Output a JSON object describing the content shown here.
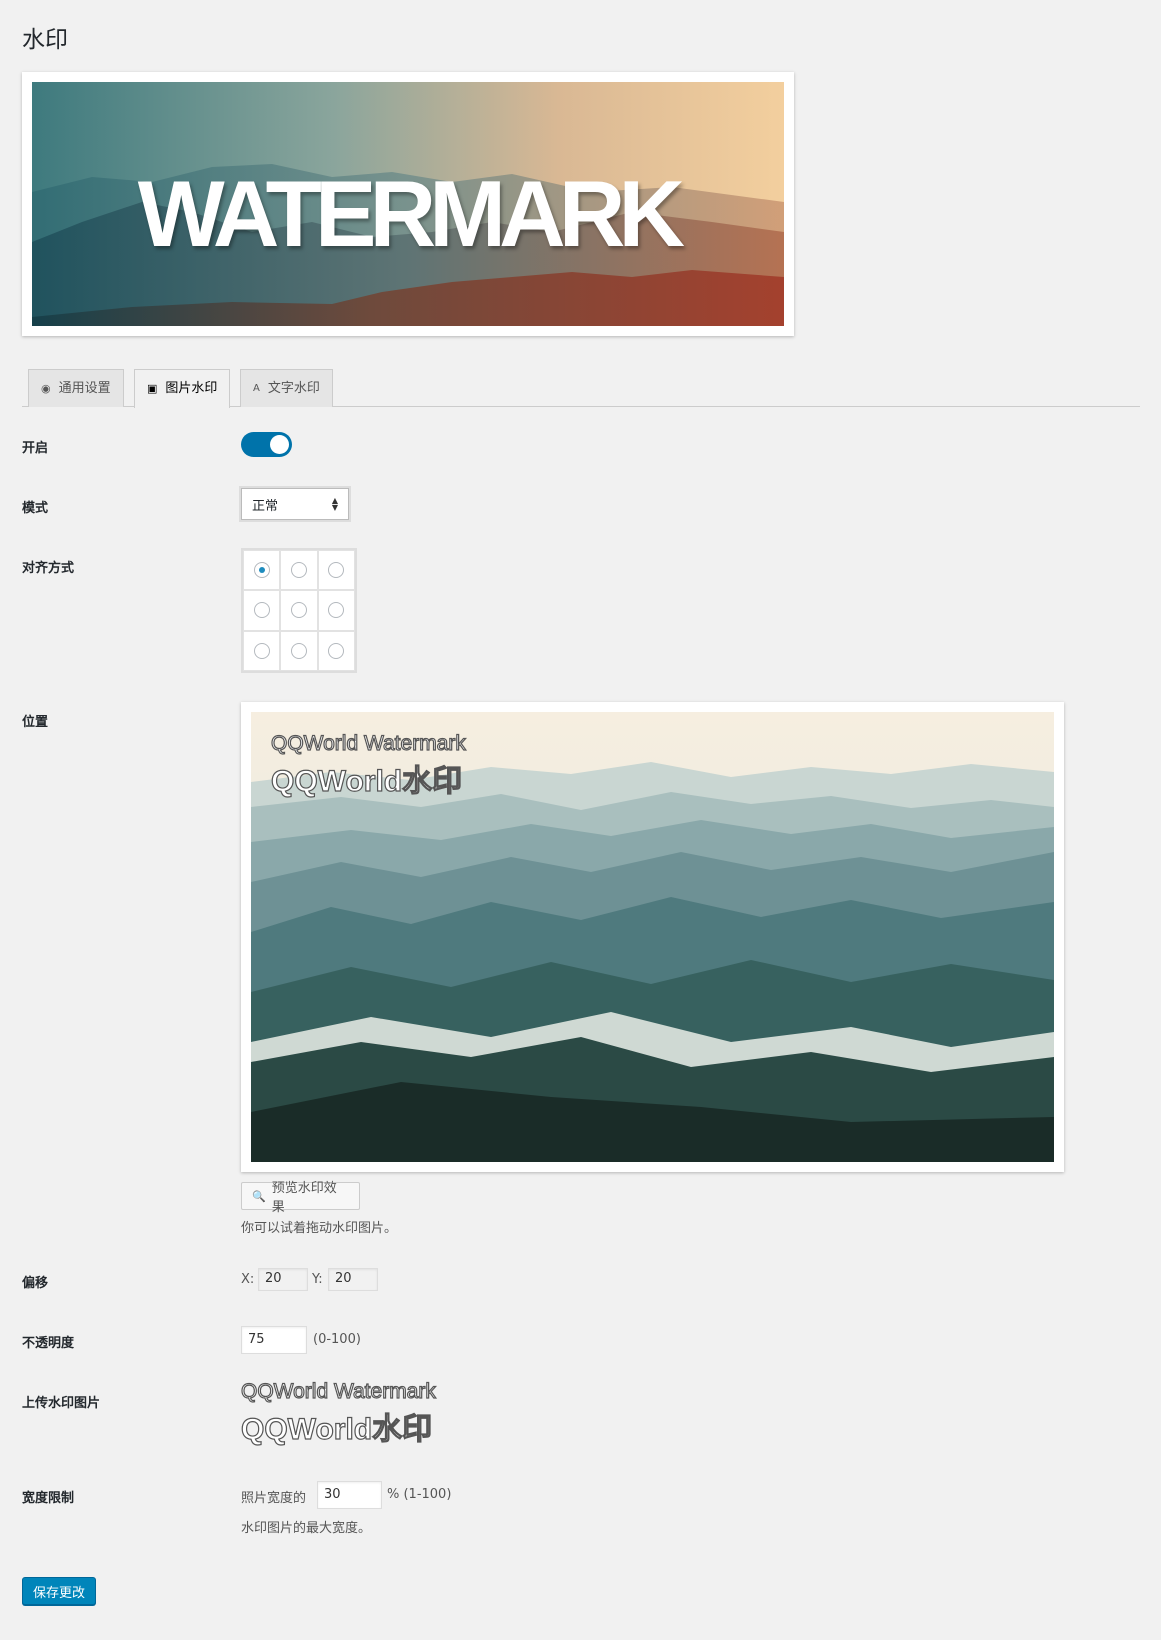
{
  "page": {
    "title": "水印"
  },
  "banner": {
    "text": "WATERMARK"
  },
  "tabs": [
    {
      "label": "通用设置",
      "icon": "dashboard-icon"
    },
    {
      "label": "图片水印",
      "icon": "image-icon"
    },
    {
      "label": "文字水印",
      "icon": "text-icon"
    }
  ],
  "fields": {
    "enable": {
      "label": "开启",
      "value": "on"
    },
    "mode": {
      "label": "模式",
      "value": "正常"
    },
    "align": {
      "label": "对齐方式",
      "selected": "top-left"
    },
    "position": {
      "label": "位置",
      "watermark_line1": "QQWorld Watermark",
      "watermark_line2": "QQWorld水印",
      "preview_button": "预览水印效果",
      "hint": "你可以试着拖动水印图片。"
    },
    "offset": {
      "label": "偏移",
      "x_label": "X:",
      "x_value": "20",
      "y_label": "Y:",
      "y_value": "20"
    },
    "opacity": {
      "label": "不透明度",
      "value": "75",
      "range": "(0-100)"
    },
    "upload": {
      "label": "上传水印图片",
      "line1": "QQWorld Watermark",
      "line2": "QQWorld水印"
    },
    "width_limit": {
      "label": "宽度限制",
      "prefix": "照片宽度的",
      "value": "30",
      "suffix": "% (1-100)",
      "hint": "水印图片的最大宽度。"
    }
  },
  "save_button": "保存更改",
  "colors": {
    "accent": "#0073aa",
    "button": "#0085ba"
  }
}
